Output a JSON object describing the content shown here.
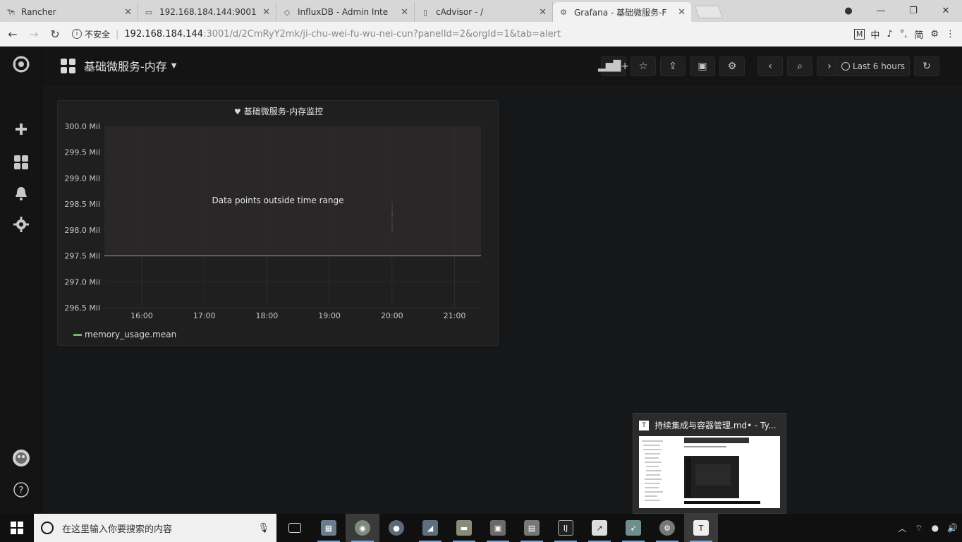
{
  "browser": {
    "tabs": [
      {
        "title": "Rancher",
        "icon": "rancher-icon"
      },
      {
        "title": "192.168.184.144:9001",
        "icon": "page-icon"
      },
      {
        "title": "InfluxDB - Admin Inte",
        "icon": "influxdb-icon"
      },
      {
        "title": "cAdvisor - /",
        "icon": "page-icon"
      },
      {
        "title": "Grafana - 基础微服务-F",
        "icon": "grafana-icon"
      }
    ],
    "security_label": "不安全",
    "url_host": "192.168.184.144",
    "url_path": ":3001/d/2CmRyY2mk/ji-chu-wei-fu-wu-nei-cun?panelId=2&orgId=1&tab=alert",
    "extensions": [
      "M",
      "中",
      "♪",
      "°,",
      "简",
      "⚙",
      "⋮"
    ]
  },
  "dashboard": {
    "title": "基础微服务-内存",
    "time_range": "Last 6 hours"
  },
  "panel": {
    "title": "基础微服务-内存监控",
    "message": "Data points outside time range",
    "legend": "memory_usage.mean"
  },
  "chart_data": {
    "type": "line",
    "title": "基础微服务-内存监控",
    "y_ticks": [
      "300.0 Mil",
      "299.5 Mil",
      "299.0 Mil",
      "298.5 Mil",
      "298.0 Mil",
      "297.5 Mil",
      "297.0 Mil",
      "296.5 Mil"
    ],
    "x_ticks": [
      "16:00",
      "17:00",
      "18:00",
      "19:00",
      "20:00",
      "21:00"
    ],
    "ylim": [
      296.5,
      300.0
    ],
    "y_unit": "Mil",
    "series": [
      {
        "name": "memory_usage.mean",
        "values": [
          297.5,
          297.5,
          297.5,
          297.5,
          297.5,
          297.5
        ],
        "color": "#7eb26d"
      }
    ],
    "alert_threshold": 297.5,
    "grid": true
  },
  "preview": {
    "title": "持续集成与容器管理.md• - Ty..."
  },
  "taskbar": {
    "search_placeholder": "在这里输入你要搜索的内容"
  }
}
